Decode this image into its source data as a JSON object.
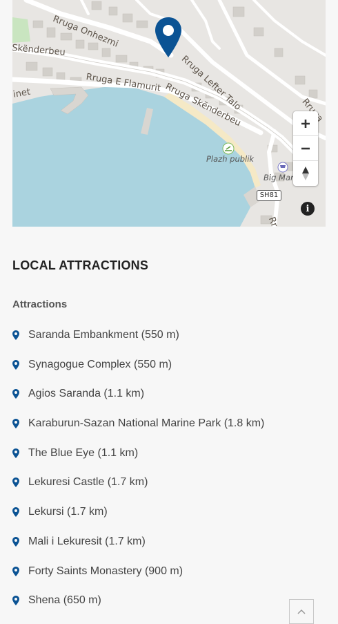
{
  "map": {
    "streets": [
      "Rruga Onhezmi",
      "Skënderbeu",
      "Rruga E Flamurit",
      "Rruga Lefter Talo",
      "Rruga Skënderbeu",
      "Rruga",
      "inet",
      "Rr"
    ],
    "pois": [
      "Plazh publik",
      "Big Mark"
    ],
    "road_shield": "SH81",
    "controls": {
      "zoom_in": "+",
      "zoom_out": "−",
      "reset_bearing": "compass-icon",
      "info": "i"
    },
    "colors": {
      "water": "#aad3df",
      "beach": "#f5e9c6",
      "land": "#e8e6e3",
      "building": "#d7d4cf",
      "road": "#ffffff",
      "pin": "#0b5394"
    }
  },
  "attractions": {
    "heading": "LOCAL ATTRACTIONS",
    "subheading": "Attractions",
    "items": [
      "Saranda Embankment (550 m)",
      "Synagogue Complex (550 m)",
      "Agios Saranda (1.1 km)",
      "Karaburun-Sazan National Marine Park (1.8 km)",
      "The Blue Eye (1.1 km)",
      "Lekuresi Castle (1.7 km)",
      "Lekursi (1.7 km)",
      "Mali i Lekuresit (1.7 km)",
      "Forty Saints Monastery (900 m)",
      "Shena (650 m)"
    ],
    "marker_icon": "map-marker-icon",
    "marker_color": "#0b5394"
  },
  "back_to_top": {
    "icon": "chevron-up-icon"
  }
}
